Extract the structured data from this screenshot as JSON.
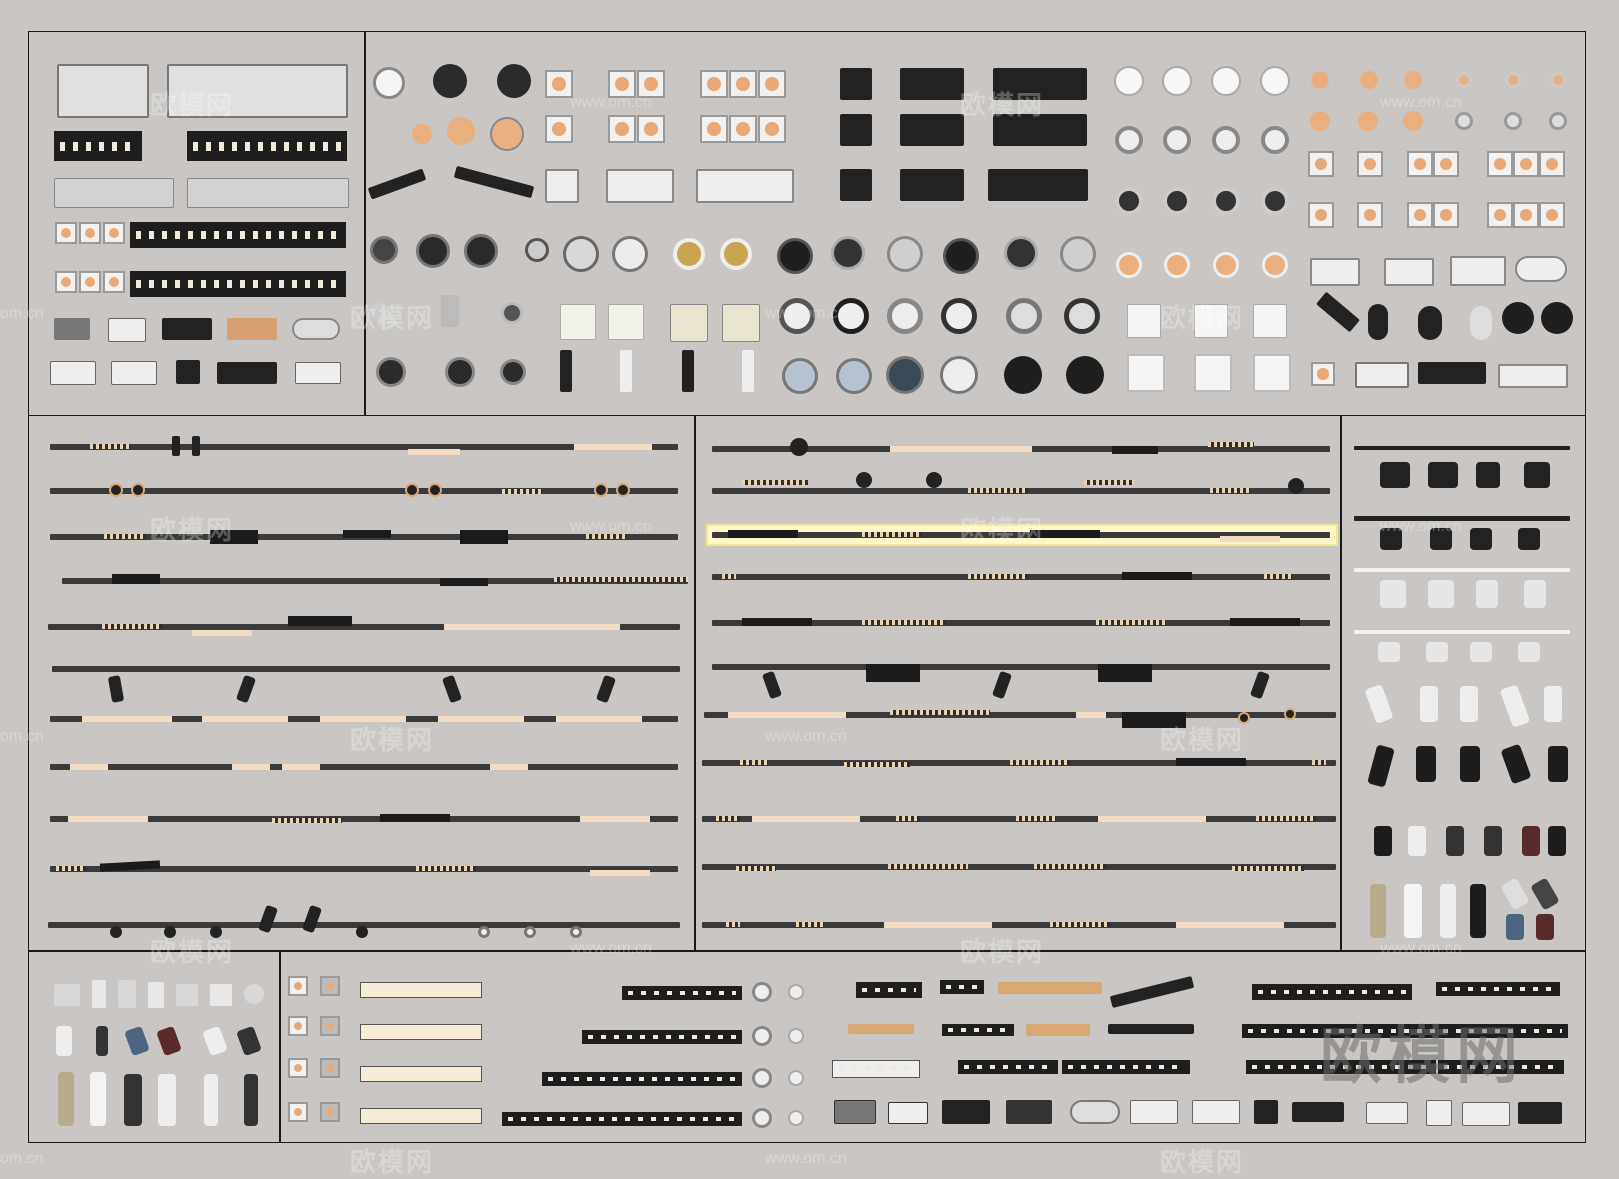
{
  "image": {
    "subject": "lighting",
    "colors": {
      "background": "#c9c6c3",
      "frame": "#1a1a1a",
      "track": "#3a3a3a",
      "warm_light": "#e8a977",
      "highlight": "#fdf6c5"
    }
  },
  "watermarks": {
    "brand": "欧模网",
    "url": "www.om.cn",
    "edge_url": "om.cn"
  }
}
